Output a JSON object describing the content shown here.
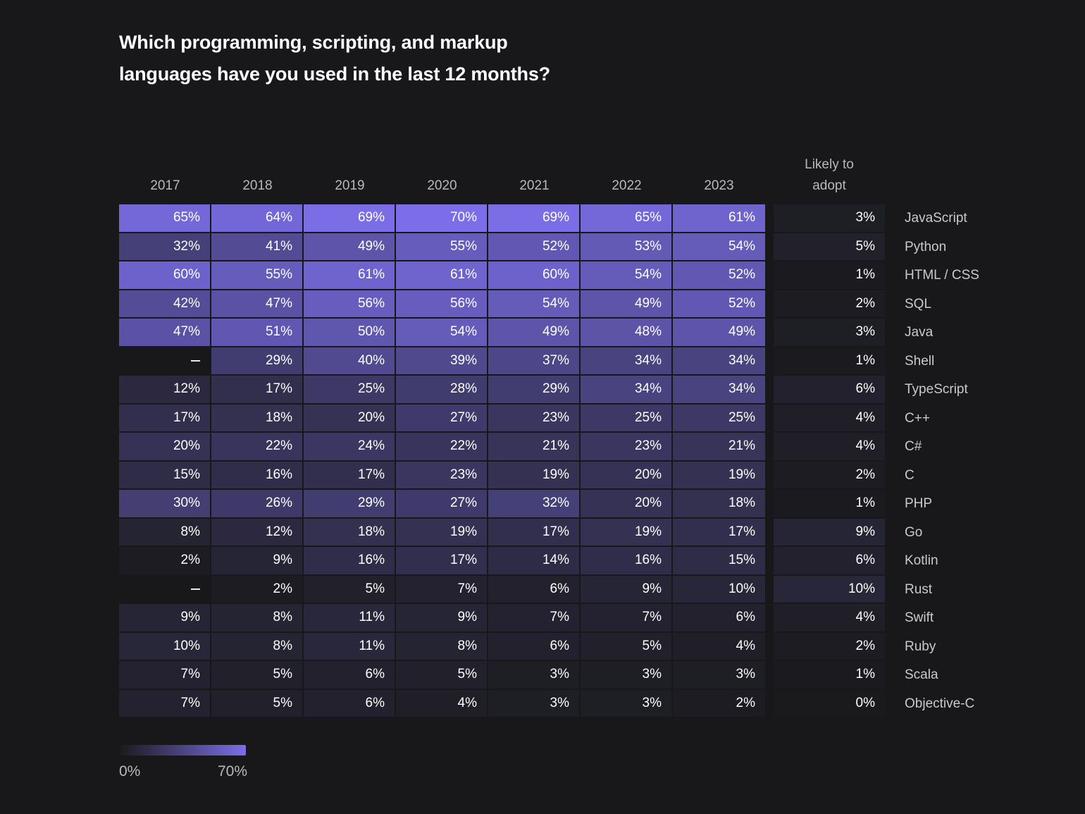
{
  "title": "Which programming, scripting, and markup\nlanguages have you used in the last 12 months?",
  "columns": {
    "years": [
      "2017",
      "2018",
      "2019",
      "2020",
      "2021",
      "2022",
      "2023"
    ],
    "adopt_header": "Likely to\nadopt"
  },
  "legend": {
    "min_label": "0%",
    "max_label": "70%",
    "min_color": "#1a1a1c",
    "max_color": "#7b6ee8",
    "scale_max": 70
  },
  "colors": {
    "background": "#18181a",
    "accent": "#7b6ee8",
    "grid_gap": "#18181a",
    "header_text": "#b9b9bd",
    "label_text": "#c9c9ce",
    "value_text": "#ffffff"
  },
  "chart_data": {
    "type": "heatmap",
    "title": "Which programming, scripting, and markup languages have you used in the last 12 months?",
    "xlabel": "",
    "ylabel": "",
    "categories": [
      "2017",
      "2018",
      "2019",
      "2020",
      "2021",
      "2022",
      "2023",
      "Likely to adopt"
    ],
    "rows": [
      {
        "label": "JavaScript",
        "values": [
          "65%",
          "64%",
          "69%",
          "70%",
          "69%",
          "65%",
          "61%"
        ],
        "adopt": "3%",
        "numeric": [
          65,
          64,
          69,
          70,
          69,
          65,
          61
        ],
        "adopt_numeric": 3
      },
      {
        "label": "Python",
        "values": [
          "32%",
          "41%",
          "49%",
          "55%",
          "52%",
          "53%",
          "54%"
        ],
        "adopt": "5%",
        "numeric": [
          32,
          41,
          49,
          55,
          52,
          53,
          54
        ],
        "adopt_numeric": 5
      },
      {
        "label": "HTML / CSS",
        "values": [
          "60%",
          "55%",
          "61%",
          "61%",
          "60%",
          "54%",
          "52%"
        ],
        "adopt": "1%",
        "numeric": [
          60,
          55,
          61,
          61,
          60,
          54,
          52
        ],
        "adopt_numeric": 1
      },
      {
        "label": "SQL",
        "values": [
          "42%",
          "47%",
          "56%",
          "56%",
          "54%",
          "49%",
          "52%"
        ],
        "adopt": "2%",
        "numeric": [
          42,
          47,
          56,
          56,
          54,
          49,
          52
        ],
        "adopt_numeric": 2
      },
      {
        "label": "Java",
        "values": [
          "47%",
          "51%",
          "50%",
          "54%",
          "49%",
          "48%",
          "49%"
        ],
        "adopt": "3%",
        "numeric": [
          47,
          51,
          50,
          54,
          49,
          48,
          49
        ],
        "adopt_numeric": 3
      },
      {
        "label": "Shell",
        "values": [
          "–",
          "29%",
          "40%",
          "39%",
          "37%",
          "34%",
          "34%"
        ],
        "adopt": "1%",
        "numeric": [
          null,
          29,
          40,
          39,
          37,
          34,
          34
        ],
        "adopt_numeric": 1
      },
      {
        "label": "TypeScript",
        "values": [
          "12%",
          "17%",
          "25%",
          "28%",
          "29%",
          "34%",
          "34%"
        ],
        "adopt": "6%",
        "numeric": [
          12,
          17,
          25,
          28,
          29,
          34,
          34
        ],
        "adopt_numeric": 6
      },
      {
        "label": "C++",
        "values": [
          "17%",
          "18%",
          "20%",
          "27%",
          "23%",
          "25%",
          "25%"
        ],
        "adopt": "4%",
        "numeric": [
          17,
          18,
          20,
          27,
          23,
          25,
          25
        ],
        "adopt_numeric": 4
      },
      {
        "label": "C#",
        "values": [
          "20%",
          "22%",
          "24%",
          "22%",
          "21%",
          "23%",
          "21%"
        ],
        "adopt": "4%",
        "numeric": [
          20,
          22,
          24,
          22,
          21,
          23,
          21
        ],
        "adopt_numeric": 4
      },
      {
        "label": "C",
        "values": [
          "15%",
          "16%",
          "17%",
          "23%",
          "19%",
          "20%",
          "19%"
        ],
        "adopt": "2%",
        "numeric": [
          15,
          16,
          17,
          23,
          19,
          20,
          19
        ],
        "adopt_numeric": 2
      },
      {
        "label": "PHP",
        "values": [
          "30%",
          "26%",
          "29%",
          "27%",
          "32%",
          "20%",
          "18%"
        ],
        "adopt": "1%",
        "numeric": [
          30,
          26,
          29,
          27,
          32,
          20,
          18
        ],
        "adopt_numeric": 1
      },
      {
        "label": "Go",
        "values": [
          "8%",
          "12%",
          "18%",
          "19%",
          "17%",
          "19%",
          "17%"
        ],
        "adopt": "9%",
        "numeric": [
          8,
          12,
          18,
          19,
          17,
          19,
          17
        ],
        "adopt_numeric": 9
      },
      {
        "label": "Kotlin",
        "values": [
          "2%",
          "9%",
          "16%",
          "17%",
          "14%",
          "16%",
          "15%"
        ],
        "adopt": "6%",
        "numeric": [
          2,
          9,
          16,
          17,
          14,
          16,
          15
        ],
        "adopt_numeric": 6
      },
      {
        "label": "Rust",
        "values": [
          "–",
          "2%",
          "5%",
          "7%",
          "6%",
          "9%",
          "10%"
        ],
        "adopt": "10%",
        "numeric": [
          null,
          2,
          5,
          7,
          6,
          9,
          10
        ],
        "adopt_numeric": 10
      },
      {
        "label": "Swift",
        "values": [
          "9%",
          "8%",
          "11%",
          "9%",
          "7%",
          "7%",
          "6%"
        ],
        "adopt": "4%",
        "numeric": [
          9,
          8,
          11,
          9,
          7,
          7,
          6
        ],
        "adopt_numeric": 4
      },
      {
        "label": "Ruby",
        "values": [
          "10%",
          "8%",
          "11%",
          "8%",
          "6%",
          "5%",
          "4%"
        ],
        "adopt": "2%",
        "numeric": [
          10,
          8,
          11,
          8,
          6,
          5,
          4
        ],
        "adopt_numeric": 2
      },
      {
        "label": "Scala",
        "values": [
          "7%",
          "5%",
          "6%",
          "5%",
          "3%",
          "3%",
          "3%"
        ],
        "adopt": "1%",
        "numeric": [
          7,
          5,
          6,
          5,
          3,
          3,
          3
        ],
        "adopt_numeric": 1
      },
      {
        "label": "Objective-C",
        "values": [
          "7%",
          "5%",
          "6%",
          "4%",
          "3%",
          "3%",
          "2%"
        ],
        "adopt": "0%",
        "numeric": [
          7,
          5,
          6,
          4,
          3,
          3,
          2
        ],
        "adopt_numeric": 0
      }
    ]
  }
}
